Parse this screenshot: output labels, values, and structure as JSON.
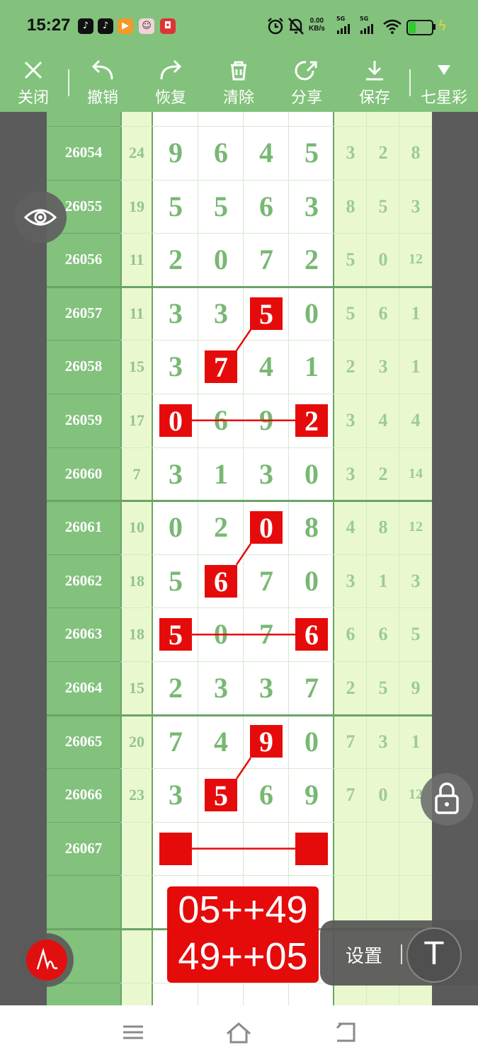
{
  "status_bar": {
    "time": "15:27",
    "net_speed_value": "0.00",
    "net_speed_unit": "KB/s",
    "signal1": "5G",
    "signal2": "5G",
    "battery_fraction": 0.3,
    "app_icons": [
      "tiktok-icon",
      "tiktok-icon",
      "video-app-icon",
      "avatar-app-icon",
      "app-icon"
    ]
  },
  "toolbar": {
    "close": "关闭",
    "undo": "撤销",
    "redo": "恢复",
    "clear": "清除",
    "share": "分享",
    "save": "保存",
    "lottery": "七星彩"
  },
  "rows": [
    {
      "issue": "26054",
      "sum": "24",
      "digits": [
        "9",
        "6",
        "4",
        "5"
      ],
      "right": [
        "3",
        "2",
        "8"
      ]
    },
    {
      "issue": "26055",
      "sum": "19",
      "digits": [
        "5",
        "5",
        "6",
        "3"
      ],
      "right": [
        "8",
        "5",
        "3"
      ]
    },
    {
      "issue": "26056",
      "sum": "11",
      "digits": [
        "2",
        "0",
        "7",
        "2"
      ],
      "right": [
        "5",
        "0",
        "12"
      ]
    },
    {
      "issue": "26057",
      "sum": "11",
      "digits": [
        "3",
        "3",
        "5",
        "0"
      ],
      "right": [
        "5",
        "6",
        "1"
      ]
    },
    {
      "issue": "26058",
      "sum": "15",
      "digits": [
        "3",
        "7",
        "4",
        "1"
      ],
      "right": [
        "2",
        "3",
        "1"
      ]
    },
    {
      "issue": "26059",
      "sum": "17",
      "digits": [
        "0",
        "6",
        "9",
        "2"
      ],
      "right": [
        "3",
        "4",
        "4"
      ]
    },
    {
      "issue": "26060",
      "sum": "7",
      "digits": [
        "3",
        "1",
        "3",
        "0"
      ],
      "right": [
        "3",
        "2",
        "14"
      ]
    },
    {
      "issue": "26061",
      "sum": "10",
      "digits": [
        "0",
        "2",
        "0",
        "8"
      ],
      "right": [
        "4",
        "8",
        "12"
      ]
    },
    {
      "issue": "26062",
      "sum": "18",
      "digits": [
        "5",
        "6",
        "7",
        "0"
      ],
      "right": [
        "3",
        "1",
        "3"
      ]
    },
    {
      "issue": "26063",
      "sum": "18",
      "digits": [
        "5",
        "0",
        "7",
        "6"
      ],
      "right": [
        "6",
        "6",
        "5"
      ]
    },
    {
      "issue": "26064",
      "sum": "15",
      "digits": [
        "2",
        "3",
        "3",
        "7"
      ],
      "right": [
        "2",
        "5",
        "9"
      ]
    },
    {
      "issue": "26065",
      "sum": "20",
      "digits": [
        "7",
        "4",
        "9",
        "0"
      ],
      "right": [
        "7",
        "3",
        "1"
      ]
    },
    {
      "issue": "26066",
      "sum": "23",
      "digits": [
        "3",
        "5",
        "6",
        "9"
      ],
      "right": [
        "7",
        "0",
        "12"
      ]
    },
    {
      "issue": "26067",
      "sum": "",
      "digits": [
        "",
        "",
        "",
        ""
      ],
      "right": [
        "",
        "",
        ""
      ]
    }
  ],
  "highlights": [
    {
      "row": 3,
      "col": 2
    },
    {
      "row": 4,
      "col": 1
    },
    {
      "row": 5,
      "col": 0
    },
    {
      "row": 5,
      "col": 3
    },
    {
      "row": 7,
      "col": 2
    },
    {
      "row": 8,
      "col": 1
    },
    {
      "row": 9,
      "col": 0
    },
    {
      "row": 9,
      "col": 3
    },
    {
      "row": 11,
      "col": 2
    },
    {
      "row": 12,
      "col": 1
    },
    {
      "row": 13,
      "col": 0
    },
    {
      "row": 13,
      "col": 3
    }
  ],
  "result": {
    "line1": "05++49",
    "line2": "49++05"
  },
  "settings": {
    "label": "设置",
    "text_tool": "T"
  },
  "colors": {
    "header_green": "#82c27c",
    "mark_red": "#e60b0b",
    "digit_green": "#78b873",
    "light_cell": "#eaf8cf"
  }
}
